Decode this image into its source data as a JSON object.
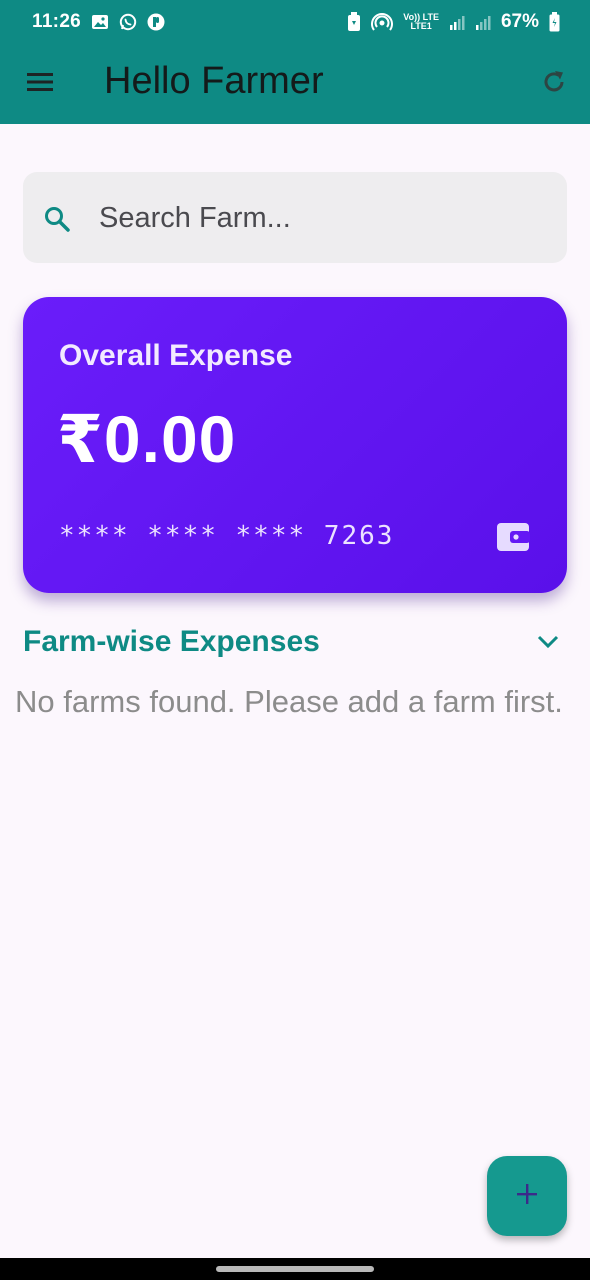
{
  "status_bar": {
    "time": "11:26",
    "lte_top": "Vo)) LTE",
    "lte_bottom": "LTE1",
    "battery": "67%",
    "icons": [
      "image-icon",
      "whatsapp-icon",
      "app-notification-icon",
      "battery-saver-icon",
      "hotspot-icon",
      "lte-icon",
      "signal-icon",
      "signal-icon",
      "battery-icon"
    ]
  },
  "appbar": {
    "title": "Hello Farmer",
    "menu_icon": "menu-icon",
    "refresh_icon": "refresh-icon",
    "background": "#0e8a84"
  },
  "search": {
    "placeholder": "Search Farm...",
    "value": "",
    "icon": "search-icon"
  },
  "expense_card": {
    "title": "Overall Expense",
    "amount": "₹0.00",
    "card_number": "**** **** **** 7263",
    "icon": "wallet-icon",
    "color": "#6a1dfa"
  },
  "farm_section": {
    "title": "Farm-wise Expenses",
    "chevron_icon": "chevron-down-icon",
    "empty_message": "No farms found. Please add a farm first."
  },
  "fab": {
    "icon": "plus-icon",
    "color": "#15998f"
  },
  "colors": {
    "accent": "#0e8a84",
    "background": "#fcf7fd"
  }
}
